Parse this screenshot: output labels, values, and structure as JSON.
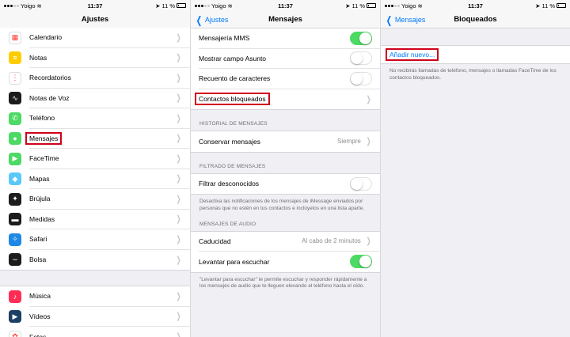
{
  "status": {
    "carrier": "Yoigo",
    "time": "11:37",
    "battery": "11 %"
  },
  "screen1": {
    "title": "Ajustes",
    "groupA": [
      {
        "label": "Calendario",
        "icon": "calendar-icon",
        "color": "#ffffff"
      },
      {
        "label": "Notas",
        "icon": "notes-icon",
        "color": "#ffcc00"
      },
      {
        "label": "Recordatorios",
        "icon": "reminders-icon",
        "color": "#ffffff"
      },
      {
        "label": "Notas de Voz",
        "icon": "voice-memos-icon",
        "color": "#1c1c1e"
      },
      {
        "label": "Teléfono",
        "icon": "phone-icon",
        "color": "#4cd964"
      },
      {
        "label": "Mensajes",
        "icon": "messages-icon",
        "color": "#4cd964"
      },
      {
        "label": "FaceTime",
        "icon": "facetime-icon",
        "color": "#4cd964"
      },
      {
        "label": "Mapas",
        "icon": "maps-icon",
        "color": "#5ac8fa"
      },
      {
        "label": "Brújula",
        "icon": "compass-icon",
        "color": "#1c1c1e"
      },
      {
        "label": "Medidas",
        "icon": "measure-icon",
        "color": "#1c1c1e"
      },
      {
        "label": "Safari",
        "icon": "safari-icon",
        "color": "#1e88e5"
      },
      {
        "label": "Bolsa",
        "icon": "stocks-icon",
        "color": "#1c1c1e"
      }
    ],
    "groupB": [
      {
        "label": "Música",
        "icon": "music-icon",
        "color": "#ff2d55"
      },
      {
        "label": "Vídeos",
        "icon": "videos-icon",
        "color": "#1c3f66"
      },
      {
        "label": "Fotos",
        "icon": "photos-icon",
        "color": "#ffffff"
      }
    ]
  },
  "screen2": {
    "back": "Ajustes",
    "title": "Mensajes",
    "rows1": {
      "mms": "Mensajería MMS",
      "subject": "Mostrar campo Asunto",
      "count": "Recuento de caracteres",
      "blocked": "Contactos bloqueados"
    },
    "history_header": "HISTORIAL DE MENSAJES",
    "keep": {
      "label": "Conservar mensajes",
      "value": "Siempre"
    },
    "filter_header": "FILTRADO DE MENSAJES",
    "filter": {
      "label": "Filtrar desconocidos"
    },
    "filter_footer": "Desactiva las notificaciones de los mensajes de iMessage enviados por personas que no estén en tus contactos e inclúyelos en una lista aparte.",
    "audio_header": "MENSAJES DE AUDIO",
    "expire": {
      "label": "Caducidad",
      "value": "Al cabo de 2 minutos"
    },
    "raise": {
      "label": "Levantar para escuchar"
    },
    "audio_footer": "\"Levantar para escuchar\" te permite escuchar y responder rápidamente a los mensajes de audio que te lleguen elevando el teléfono hasta el oído."
  },
  "screen3": {
    "back": "Mensajes",
    "title": "Bloqueados",
    "add": "Añadir nuevo...",
    "footer": "No recibirás llamadas de teléfono, mensajes o llamadas FaceTime de los contactos bloqueados."
  }
}
